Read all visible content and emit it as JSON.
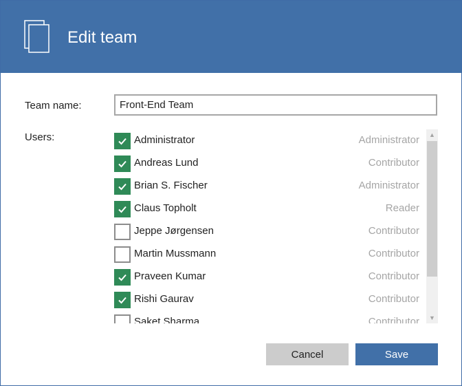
{
  "dialog": {
    "title": "Edit team",
    "header_color": "#4170a8",
    "header_icon": "documents-icon"
  },
  "team_name": {
    "label": "Team name:",
    "value": "Front-End Team"
  },
  "users": {
    "label": "Users:",
    "items": [
      {
        "name": "Administrator",
        "role": "Administrator",
        "checked": true
      },
      {
        "name": "Andreas Lund",
        "role": "Contributor",
        "checked": true
      },
      {
        "name": "Brian S. Fischer",
        "role": "Administrator",
        "checked": true
      },
      {
        "name": "Claus Topholt",
        "role": "Reader",
        "checked": true
      },
      {
        "name": "Jeppe Jørgensen",
        "role": "Contributor",
        "checked": false
      },
      {
        "name": "Martin Mussmann",
        "role": "Contributor",
        "checked": false
      },
      {
        "name": "Praveen Kumar",
        "role": "Contributor",
        "checked": true
      },
      {
        "name": "Rishi Gaurav",
        "role": "Contributor",
        "checked": true
      },
      {
        "name": "Saket Sharma",
        "role": "Contributor",
        "checked": false
      }
    ]
  },
  "buttons": {
    "cancel_label": "Cancel",
    "save_label": "Save"
  },
  "colors": {
    "checked": "#2f8a57",
    "primary_button": "#4170a8",
    "secondary_button": "#cccccc",
    "role_text": "#a5a5a5"
  }
}
